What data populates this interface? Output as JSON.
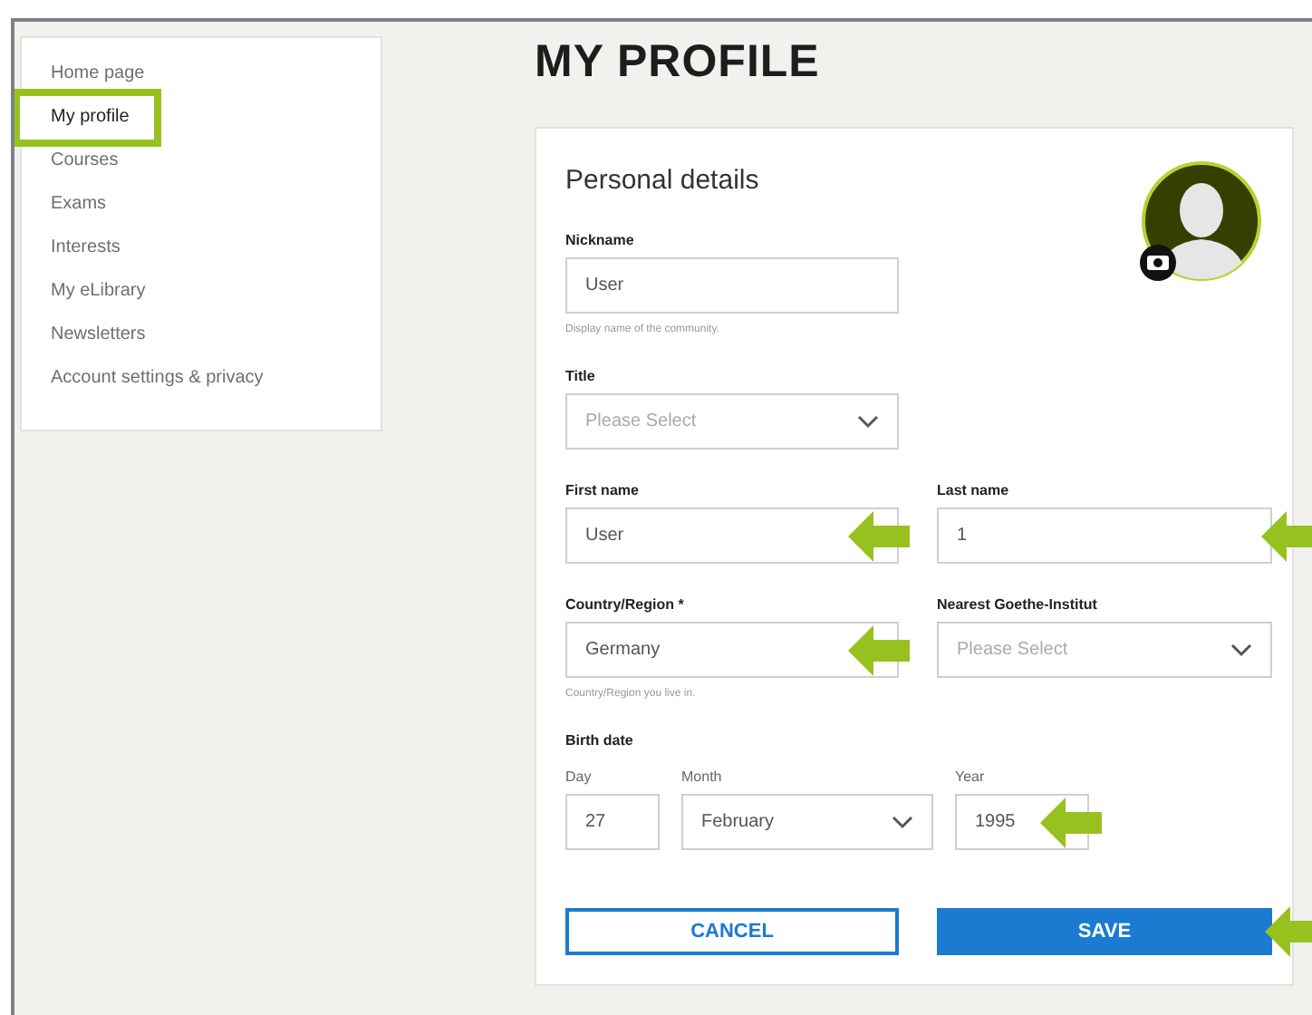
{
  "sidebar": {
    "items": [
      {
        "label": "Home page",
        "selected": false
      },
      {
        "label": "My profile",
        "selected": true
      },
      {
        "label": "Courses",
        "selected": false
      },
      {
        "label": "Exams",
        "selected": false
      },
      {
        "label": "Interests",
        "selected": false
      },
      {
        "label": "My eLibrary",
        "selected": false
      },
      {
        "label": "Newsletters",
        "selected": false
      },
      {
        "label": "Account settings & privacy",
        "selected": false
      }
    ]
  },
  "page_title": "MY PROFILE",
  "card": {
    "title": "Personal details",
    "rows": [
      {
        "fields": [
          {
            "kind": "input",
            "label": "Nickname",
            "value": "User",
            "hint": "Display name of the community.",
            "marked": false
          }
        ]
      },
      {
        "fields": [
          {
            "kind": "select",
            "label": "Title",
            "placeholder": "Please Select",
            "marked": false
          }
        ]
      },
      {
        "fields": [
          {
            "kind": "input",
            "label": "First name",
            "value": "User",
            "marked": true
          },
          {
            "kind": "input",
            "label": "Last name",
            "value": "1",
            "marked": true
          }
        ]
      },
      {
        "fields": [
          {
            "kind": "input",
            "label": "Country/Region *",
            "value": "Germany",
            "hint": "Country/Region you live in.",
            "marked": true
          },
          {
            "kind": "select",
            "label": "Nearest Goethe-Institut",
            "placeholder": "Please Select",
            "marked": false
          }
        ]
      }
    ],
    "birth_date": {
      "label": "Birth date",
      "parts": [
        {
          "kind": "input",
          "label": "Day",
          "value": "27",
          "marked": false
        },
        {
          "kind": "select",
          "label": "Month",
          "value": "February",
          "marked": false
        },
        {
          "kind": "input",
          "label": "Year",
          "value": "1995",
          "marked": true
        }
      ]
    },
    "buttons": [
      {
        "kind": "secondary",
        "label": "CANCEL",
        "marked": false
      },
      {
        "kind": "primary",
        "label": "SAVE",
        "marked": true
      }
    ]
  }
}
